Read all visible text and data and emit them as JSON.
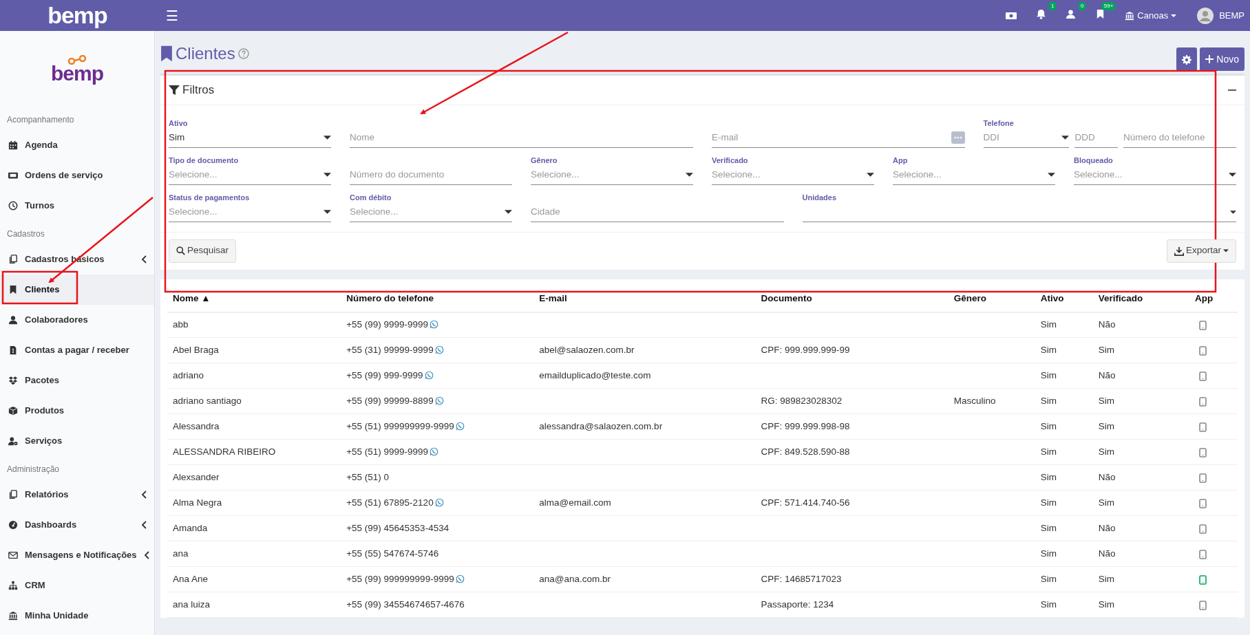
{
  "topbar": {
    "logo": "bemp",
    "menu_glyph": "☰",
    "notifications": [
      {
        "count": "1"
      },
      {
        "count": "0"
      },
      {
        "count": "59+"
      }
    ],
    "unit": "Canoas",
    "user": "BEMP"
  },
  "sidebar": {
    "logo": "bemp",
    "sections": [
      {
        "title": "Acompanhamento",
        "items": [
          {
            "label": "Agenda",
            "expandable": false,
            "selected": false
          },
          {
            "label": "Ordens de serviço",
            "expandable": false,
            "selected": false
          },
          {
            "label": "Turnos",
            "expandable": false,
            "selected": false
          }
        ]
      },
      {
        "title": "Cadastros",
        "items": [
          {
            "label": "Cadastros básicos",
            "expandable": true,
            "selected": false
          },
          {
            "label": "Clientes",
            "expandable": false,
            "selected": true
          },
          {
            "label": "Colaboradores",
            "expandable": false,
            "selected": false
          },
          {
            "label": "Contas a pagar / receber",
            "expandable": false,
            "selected": false
          },
          {
            "label": "Pacotes",
            "expandable": false,
            "selected": false
          },
          {
            "label": "Produtos",
            "expandable": false,
            "selected": false
          },
          {
            "label": "Serviços",
            "expandable": false,
            "selected": false
          }
        ]
      },
      {
        "title": "Administração",
        "items": [
          {
            "label": "Relatórios",
            "expandable": true,
            "selected": false
          },
          {
            "label": "Dashboards",
            "expandable": true,
            "selected": false
          },
          {
            "label": "Mensagens e Notificações",
            "expandable": true,
            "selected": false
          },
          {
            "label": "CRM",
            "expandable": false,
            "selected": false
          },
          {
            "label": "Minha Unidade",
            "expandable": false,
            "selected": false
          }
        ]
      }
    ]
  },
  "page": {
    "title": "Clientes",
    "new_button": "Novo"
  },
  "filters": {
    "title": "Filtros",
    "fields": [
      {
        "kind": "select",
        "label": "Ativo",
        "value": "Sim"
      },
      {
        "kind": "input",
        "placeholder": "Nome"
      },
      {
        "kind": "input_button",
        "placeholder": "E-mail"
      },
      {
        "kind": "phone",
        "label": "Telefone",
        "ddi": "DDI",
        "ddd": "DDD",
        "number": "Número do telefone"
      },
      {
        "kind": "select",
        "label": "Tipo de documento",
        "placeholder": "Selecione..."
      },
      {
        "kind": "input",
        "placeholder": "Número do documento"
      },
      {
        "kind": "select",
        "label": "Gênero",
        "placeholder": "Selecione..."
      },
      {
        "kind": "select",
        "label": "Verificado",
        "placeholder": "Selecione..."
      },
      {
        "kind": "select",
        "label": "App",
        "placeholder": "Selecione..."
      },
      {
        "kind": "select",
        "label": "Bloqueado",
        "placeholder": "Selecione..."
      },
      {
        "kind": "select",
        "label": "Status de pagamentos",
        "placeholder": "Selecione..."
      },
      {
        "kind": "select",
        "label": "Com débito",
        "placeholder": "Selecione..."
      },
      {
        "kind": "input",
        "placeholder": "Cidade"
      },
      {
        "kind": "multiselect",
        "label": "Unidades"
      }
    ],
    "search_button": "Pesquisar",
    "export_button": "Exportar"
  },
  "table": {
    "columns": [
      {
        "label": "Nome",
        "sort_mark": "▲"
      },
      {
        "label": "Número do telefone"
      },
      {
        "label": "E-mail"
      },
      {
        "label": "Documento"
      },
      {
        "label": "Gênero"
      },
      {
        "label": "Ativo"
      },
      {
        "label": "Verificado"
      },
      {
        "label": "App"
      }
    ],
    "rows": [
      {
        "name": "abb",
        "phone": "+55 (99) 9999-9999",
        "whatsapp": true,
        "active": "Sim",
        "verified": "Não",
        "app_installed": false
      },
      {
        "name": "Abel Braga",
        "phone": "+55 (31) 99999-9999",
        "whatsapp": true,
        "email": "abel@salaozen.com.br",
        "document": "CPF: 999.999.999-99",
        "active": "Sim",
        "verified": "Sim",
        "app_installed": false
      },
      {
        "name": "adriano",
        "phone": "+55 (99) 999-9999",
        "whatsapp": true,
        "email": "emailduplicado@teste.com",
        "active": "Sim",
        "verified": "Não",
        "app_installed": false
      },
      {
        "name": "adriano santiago",
        "phone": "+55 (99) 99999-8899",
        "whatsapp": true,
        "document": "RG: 989823028302",
        "gender": "Masculino",
        "active": "Sim",
        "verified": "Sim",
        "app_installed": false
      },
      {
        "name": "Alessandra",
        "phone": "+55 (51) 999999999-9999",
        "whatsapp": true,
        "email": "alessandra@salaozen.com.br",
        "document": "CPF: 999.999.998-98",
        "active": "Sim",
        "verified": "Sim",
        "app_installed": false
      },
      {
        "name": "ALESSANDRA RIBEIRO",
        "phone": "+55 (51) 9999-9999",
        "whatsapp": true,
        "document": "CPF: 849.528.590-88",
        "active": "Sim",
        "verified": "Sim",
        "app_installed": false
      },
      {
        "name": "Alexsander",
        "phone": "+55 (51) 0",
        "whatsapp": false,
        "active": "Sim",
        "verified": "Não",
        "app_installed": false
      },
      {
        "name": "Alma Negra",
        "phone": "+55 (51) 67895-2120",
        "whatsapp": true,
        "email": "alma@email.com",
        "document": "CPF: 571.414.740-56",
        "active": "Sim",
        "verified": "Sim",
        "app_installed": false
      },
      {
        "name": "Amanda",
        "phone": "+55 (99) 45645353-4534",
        "whatsapp": false,
        "active": "Sim",
        "verified": "Não",
        "app_installed": false
      },
      {
        "name": "ana",
        "phone": "+55 (55) 547674-5746",
        "whatsapp": false,
        "active": "Sim",
        "verified": "Não",
        "app_installed": false
      },
      {
        "name": "Ana Ane",
        "phone": "+55 (99) 999999999-9999",
        "whatsapp": true,
        "email": "ana@ana.com.br",
        "document": "CPF: 14685717023",
        "active": "Sim",
        "verified": "Sim",
        "app_installed": true
      },
      {
        "name": "ana luiza",
        "phone": "+55 (99) 34554674657-4676",
        "whatsapp": false,
        "document": "Passaporte: 1234",
        "active": "Sim",
        "verified": "Sim",
        "app_installed": false
      }
    ]
  }
}
